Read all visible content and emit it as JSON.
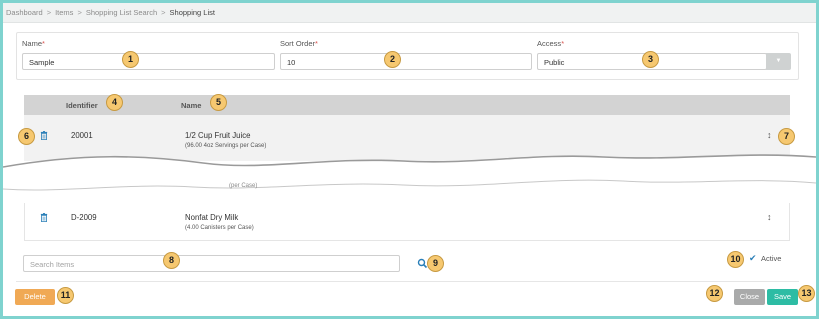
{
  "breadcrumb": [
    {
      "label": "Dashboard"
    },
    {
      "label": "Items"
    },
    {
      "label": "Shopping List Search"
    },
    {
      "label": "Shopping List"
    }
  ],
  "breadcrumb_separator": ">",
  "form": {
    "name_label": "Name",
    "name_value": "Sample",
    "sort_order_label": "Sort Order",
    "sort_order_value": "10",
    "access_label": "Access",
    "access_value": "Public",
    "required_mark": "*"
  },
  "table": {
    "columns": [
      "Identifier",
      "Name"
    ],
    "rows": [
      {
        "identifier": "20001",
        "name": "1/2 Cup Fruit Juice",
        "detail": "(96.00 4oz Servings per Case)"
      },
      {
        "identifier": "D-2009",
        "name": "Nonfat Dry Milk",
        "detail": "(4.00 Canisters per Case)"
      }
    ],
    "partial_detail": "(per Case)"
  },
  "search": {
    "placeholder": "Search Items"
  },
  "active": {
    "label": "Active",
    "checked": true
  },
  "buttons": {
    "delete": "Delete",
    "close": "Close",
    "save": "Save"
  },
  "callouts": [
    "1",
    "2",
    "3",
    "4",
    "5",
    "6",
    "7",
    "8",
    "9",
    "10",
    "11",
    "12",
    "13"
  ],
  "icons": {
    "trash": "trash-icon",
    "drag": "drag-handle-icon",
    "search": "search-icon",
    "check": "checkmark-icon",
    "dropdown": "caret-down-icon"
  },
  "colors": {
    "frame": "#7fd3cf",
    "delete": "#f0a955",
    "close": "#a9aaaa",
    "save": "#2dbca4",
    "callout": "#f6c870",
    "icon_blue": "#2a7fb8"
  }
}
